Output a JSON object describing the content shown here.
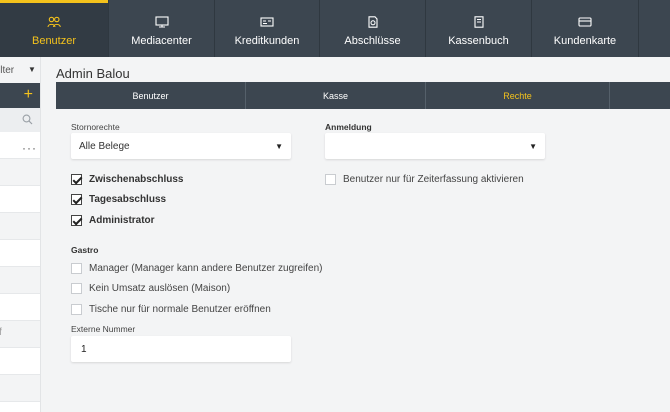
{
  "nav": {
    "items": [
      {
        "label": "Benutzer",
        "icon": "users-icon",
        "active": true
      },
      {
        "label": "Mediacenter",
        "icon": "monitor-icon"
      },
      {
        "label": "Kreditkunden",
        "icon": "card-icon"
      },
      {
        "label": "Abschlüsse",
        "icon": "document-icon"
      },
      {
        "label": "Kassenbuch",
        "icon": "book-icon"
      },
      {
        "label": "Kundenkarte",
        "icon": "customer-card-icon"
      }
    ],
    "accent_color": "#f4c21c",
    "bg_color": "#3c4650"
  },
  "left": {
    "filter_label": "ilter",
    "add_label": "+",
    "dots_label": "···",
    "f_label": "f"
  },
  "page": {
    "title": "Admin Balou",
    "tabs": [
      {
        "label": "Benutzer"
      },
      {
        "label": "Kasse"
      },
      {
        "label": "Rechte",
        "active": true
      }
    ]
  },
  "form": {
    "storno_label": "Stornorechte",
    "storno_value": "Alle Belege",
    "anmeldung_label": "Anmeldung",
    "anmeldung_value": "",
    "cb_zwischen": "Zwischenabschluss",
    "cb_tages": "Tagesabschluss",
    "cb_admin": "Administrator",
    "cb_zeit": "Benutzer nur für Zeiterfassung aktivieren",
    "gastro_label": "Gastro",
    "cb_manager": "Manager (Manager kann andere Benutzer zugreifen)",
    "cb_umsatz": "Kein Umsatz auslösen (Maison)",
    "cb_tische": "Tische nur für normale Benutzer eröffnen",
    "ext_label": "Externe Nummer",
    "ext_value": "1"
  }
}
